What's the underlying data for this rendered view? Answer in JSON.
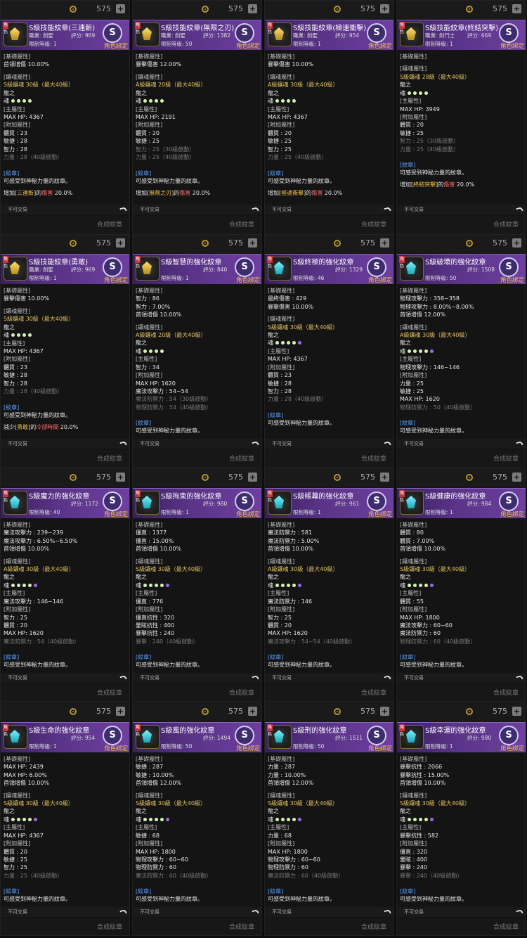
{
  "common": {
    "price": "575",
    "bind_label": "角色綁定",
    "no_trade": "不可交易",
    "synth": "合成紋章",
    "char_badge": "角色",
    "s_rank": "S",
    "desc_header": "[紋章]",
    "desc_text": "可感受到神秘力量的紋章。"
  },
  "cards": [
    {
      "title": "S級技能紋章(三連斬)",
      "meta1": "職業: 劍聖",
      "score": "評分: 969",
      "lv": "限制等級: 1",
      "emblem": "gold",
      "lines": [
        "[基礎屬性]",
        "首領增傷 10.00%",
        "",
        "[鑲魂屬性]",
        "S級鑲魂 30級（最大40級）",
        "龍之",
        "魂",
        "[主屬性]",
        "MAX HP: 4367",
        "[附加屬性]",
        "體質 : 23",
        "敏捷 : 28",
        "智力 : 28",
        "力量 : 28（40級啟動）"
      ],
      "effect": [
        "增加[",
        "三連斬",
        "]的",
        "傷害",
        " 20.0%"
      ]
    },
    {
      "title": "S級技能紋章(無限之刃)",
      "meta1": "職業: 劍聖",
      "score": "評分: 1382",
      "lv": "限制等級: 50",
      "emblem": "gold",
      "lines": [
        "[基礎屬性]",
        "暴擊傷害 12.00%",
        "",
        "[鑲魂屬性]",
        "A級鑲魂 20級（最大40級）",
        "龍之",
        "魂",
        "[主屬性]",
        "MAX HP: 2191",
        "[附加屬性]",
        "體質 : 20",
        "敏捷 : 25",
        "智力 : 25（30級啟動）",
        "力量 : 25（40級啟動）"
      ],
      "effect": [
        "增加[",
        "無限之刃",
        "]的",
        "傷害",
        " 20.0%"
      ]
    },
    {
      "title": "S級技能紋章(極速衝擊)",
      "meta1": "職業: 劍聖",
      "score": "評分: 954",
      "lv": "限制等級: 1",
      "emblem": "gold",
      "lines": [
        "[基礎屬性]",
        "暴擊傷害 10.00%",
        "",
        "[鑲魂屬性]",
        "A級鑲魂 30級（最大40級）",
        "龍之",
        "魂",
        "[主屬性]",
        "MAX HP: 4367",
        "[附加屬性]",
        "體質 : 20",
        "敏捷 : 25",
        "智力 : 25",
        "力量 : 25（40級啟動）"
      ],
      "effect": [
        "增加[",
        "極速衝擊",
        "]的",
        "傷害",
        " 20.0%"
      ]
    },
    {
      "title": "S級技能紋章(終結突擊)",
      "meta1": "職業: 劍鬥士",
      "score": "評分: 669",
      "lv": "限制等級: 1",
      "emblem": "gold",
      "lines": [
        "[基礎屬性]",
        "",
        "[鑲魂屬性]",
        "S級鑲魂 28級（最大40級）",
        "龍之",
        "魂",
        "[主屬性]",
        "MAX HP: 3949",
        "[附加屬性]",
        "體質 : 20",
        "敏捷 : 25",
        "智力 : 25（30級啟動）",
        "力量 : 25（40級啟動）"
      ],
      "effect": [
        "增加[",
        "終結突擊",
        "]的",
        "傷害",
        " 20.0%"
      ]
    },
    {
      "title": "S級技能紋章(勇敢)",
      "meta1": "職業: 劍聖",
      "score": "評分: 969",
      "lv": "限制等級: 1",
      "emblem": "gold",
      "lines": [
        "[基礎屬性]",
        "暴擊傷害 10.00%",
        "",
        "[鑲魂屬性]",
        "S級鑲魂 30級（最大40級）",
        "龍之",
        "魂",
        "[主屬性]",
        "MAX HP: 4367",
        "[附加屬性]",
        "體質 : 23",
        "敏捷 : 28",
        "智力 : 28",
        "力量 : 28（40級啟動）"
      ],
      "effect": [
        "減少[",
        "勇敢",
        "]的",
        "冷卻時間",
        " 20.0%"
      ]
    },
    {
      "title": "S級智慧的強化紋章",
      "meta1": "",
      "score": "評分: 840",
      "lv": "限制等級: 1",
      "emblem": "gold",
      "lines": [
        "[基礎屬性]",
        "智力 : 86",
        "智力 : 7.00%",
        "首領增傷 10.00%",
        "",
        "[鑲魂屬性]",
        "A級鑲魂 20級（最大40級）",
        "龍之",
        "魂",
        "[主屬性]",
        "智力 : 34",
        "[附加屬性]",
        "MAX HP: 1620",
        "魔法攻擊力 : 54~54",
        "魔法防禦力 : 54（30級啟動）",
        "物理防禦力 : 54（40級啟動）"
      ],
      "effect": null
    },
    {
      "title": "S級終極的強化紋章",
      "meta1": "",
      "score": "評分: 1329",
      "lv": "限制等級: 46",
      "emblem": "teal",
      "lines": [
        "[基礎屬性]",
        "最終傷害 : 429",
        "暴擊傷害 10.00%",
        "",
        "[鑲魂屬性]",
        "S級鑲魂 30級（最大40級）",
        "龍之",
        "魂",
        "[主屬性]",
        "MAX HP: 4367",
        "[附加屬性]",
        "體質 : 23",
        "敏捷 : 28",
        "智力 : 28",
        "力量 : 28（40級啟動）"
      ],
      "effect": null
    },
    {
      "title": "S級破壞的強化紋章",
      "meta1": "",
      "score": "評分: 1508",
      "lv": "限制等級: 50",
      "emblem": "teal",
      "lines": [
        "[基礎屬性]",
        "物理攻擊力 : 358~358",
        "物理攻擊力 : 8.00%~8.00%",
        "首領增傷 12.00%",
        "",
        "[鑲魂屬性]",
        "A級鑲魂 30級（最大40級）",
        "龍之",
        "魂",
        "[主屬性]",
        "物理攻擊力 : 146~146",
        "[附加屬性]",
        "力量 : 25",
        "敏捷 : 25",
        "MAX HP: 1620",
        "物理防禦力 : 50（40級啟動）"
      ],
      "effect": null
    },
    {
      "title": "S級魔力的強化紋章",
      "meta1": "",
      "score": "評分: 1172",
      "lv": "限制等級: 40",
      "emblem": "teal",
      "lines": [
        "[基礎屬性]",
        "魔法攻擊力 : 239~239",
        "魔法攻擊力 : 6.50%~6.50%",
        "首領增傷 10.00%",
        "",
        "[鑲魂屬性]",
        "A級鑲魂 30級（最大40級）",
        "龍之",
        "魂",
        "[主屬性]",
        "魔法攻擊力 : 146~146",
        "[附加屬性]",
        "智力 : 25",
        "體質 : 20",
        "MAX HP: 1620",
        "魔法防禦力 : 54（40級啟動）"
      ],
      "effect": null
    },
    {
      "title": "S級拘束的強化紋章",
      "meta1": "",
      "score": "評分: 980",
      "lv": "限制等級: 1",
      "emblem": "teal",
      "lines": [
        "[基礎屬性]",
        "僵直 : 1377",
        "僵直 : 15.00%",
        "首領增傷 10.00%",
        "",
        "[鑲魂屬性]",
        "S級鑲魂 30級（最大40級）",
        "龍之",
        "魂",
        "[主屬性]",
        "僵直 : 776",
        "[附加屬性]",
        "僵直抗性 : 320",
        "暈眩抗性 : 400",
        "暴擊抗性 : 240",
        "暴擊 : 240（40級啟動）"
      ],
      "effect": null
    },
    {
      "title": "S級帳幕的強化紋章",
      "meta1": "",
      "score": "評分: 961",
      "lv": "限制等級: 1",
      "emblem": "teal",
      "lines": [
        "[基礎屬性]",
        "魔法防禦力 : 581",
        "魔法防禦力 : 5.00%",
        "首領增傷 10.00%",
        "",
        "[鑲魂屬性]",
        "A級鑲魂 30級（最大40級）",
        "龍之",
        "魂",
        "[主屬性]",
        "魔法防禦力 : 146",
        "[附加屬性]",
        "智力 : 25",
        "體質 : 20",
        "MAX HP: 1620",
        "魔法攻擊力 : 54~54（40級啟動）"
      ],
      "effect": null
    },
    {
      "title": "S級健康的強化紋章",
      "meta1": "",
      "score": "評分: 984",
      "lv": "限制等級: 1",
      "emblem": "teal",
      "lines": [
        "[基礎屬性]",
        "體質 : 80",
        "體質 : 7.00%",
        "首領增傷 10.00%",
        "",
        "[鑲魂屬性]",
        "S級鑲魂 30級（最大40級）",
        "龍之",
        "魂",
        "[主屬性]",
        "體質 : 55",
        "[附加屬性]",
        "MAX HP: 1800",
        "魔法攻擊力 : 60~60",
        "魔法防禦力 : 60",
        "物理防禦力 : 60（40級啟動）"
      ],
      "effect": null
    },
    {
      "title": "S級生命的強化紋章",
      "meta1": "",
      "score": "評分: 954",
      "lv": "限制等級: 1",
      "emblem": "teal",
      "lines": [
        "[基礎屬性]",
        "MAX HP: 2439",
        "MAX HP: 6.00%",
        "首領增傷 10.00%",
        "",
        "[鑲魂屬性]",
        "S級鑲魂 30級（最大40級）",
        "龍之",
        "魂",
        "[主屬性]",
        "MAX HP: 4367",
        "[附加屬性]",
        "體質 : 20",
        "敏捷 : 25",
        "智力 : 25",
        "力量 : 25（40級啟動）"
      ],
      "effect": null
    },
    {
      "title": "S級風的強化紋章",
      "meta1": "",
      "score": "評分: 1494",
      "lv": "限制等級: 50",
      "emblem": "teal",
      "lines": [
        "[基礎屬性]",
        "敏捷 : 287",
        "敏捷 : 10.00%",
        "首領增傷 12.00%",
        "",
        "[鑲魂屬性]",
        "S級鑲魂 30級（最大40級）",
        "龍之",
        "魂",
        "[主屬性]",
        "敏捷 : 68",
        "[附加屬性]",
        "MAX HP: 1800",
        "物理攻擊力 : 60~60",
        "物理防禦力 : 60",
        "魔法防禦力 : 60（40級啟動）"
      ],
      "effect": null
    },
    {
      "title": "S級刑的強化紋章",
      "meta1": "",
      "score": "評分: 1511",
      "lv": "限制等級: 50",
      "emblem": "teal",
      "lines": [
        "[基礎屬性]",
        "力量 : 287",
        "力量 : 10.00%",
        "首領增傷 12.00%",
        "",
        "[鑲魂屬性]",
        "S級鑲魂 30級（最大40級）",
        "龍之",
        "魂",
        "[主屬性]",
        "力量 : 68",
        "[附加屬性]",
        "MAX HP: 1800",
        "物理攻擊力 : 60~60",
        "物理防禦力 : 60",
        "魔法防禦力 : 60（40級啟動）"
      ],
      "effect": null
    },
    {
      "title": "S級幸運的強化紋章",
      "meta1": "",
      "score": "評分: 980",
      "lv": "限制等級: 1",
      "emblem": "teal",
      "lines": [
        "[基礎屬性]",
        "暴擊抗性 : 2066",
        "暴擊抗性 : 15.00%",
        "首領增傷 10.00%",
        "",
        "[鑲魂屬性]",
        "S級鑲魂 30級（最大40級）",
        "龍之",
        "魂",
        "[主屬性]",
        "暴擊抗性 : 582",
        "[附加屬性]",
        "僵直 : 320",
        "暈眩 : 400",
        "暴擊 : 240",
        "暴擊 : 240（40級啟動）"
      ],
      "effect": null
    }
  ]
}
